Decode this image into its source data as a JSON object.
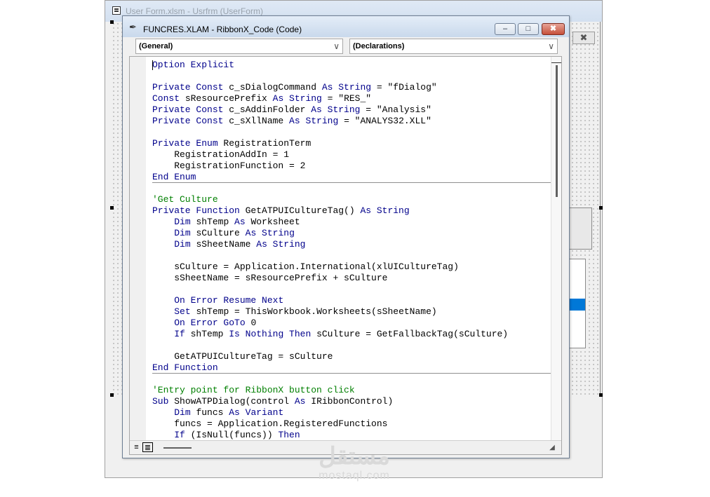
{
  "background_window": {
    "title": "User Form.xlsm - Usrfrm (UserForm)",
    "close_glyph": "✖"
  },
  "code_window": {
    "title": "FUNCRES.XLAM - RibbonX_Code (Code)",
    "icon": "vba-module-icon",
    "minimize_glyph": "–",
    "maximize_glyph": "□",
    "close_glyph": "✖",
    "object_combo": "(General)",
    "procedure_combo": "(Declarations)",
    "combo_arrow": "⌵"
  },
  "colors": {
    "keyword": "#00008b",
    "comment": "#007f00",
    "selection": "#0078d7"
  },
  "code_lines": [
    [
      {
        "t": "Option Explicit",
        "c": "kw"
      }
    ],
    [],
    [
      {
        "t": "Private Const ",
        "c": "kw"
      },
      {
        "t": "c_sDialogCommand "
      },
      {
        "t": "As String",
        "c": "kw"
      },
      {
        "t": " = \"fDialog\""
      }
    ],
    [
      {
        "t": "Const ",
        "c": "kw"
      },
      {
        "t": "sResourcePrefix "
      },
      {
        "t": "As String",
        "c": "kw"
      },
      {
        "t": " = \"RES_\""
      }
    ],
    [
      {
        "t": "Private Const ",
        "c": "kw"
      },
      {
        "t": "c_sAddinFolder "
      },
      {
        "t": "As String",
        "c": "kw"
      },
      {
        "t": " = \"Analysis\""
      }
    ],
    [
      {
        "t": "Private Const ",
        "c": "kw"
      },
      {
        "t": "c_sXllName "
      },
      {
        "t": "As String",
        "c": "kw"
      },
      {
        "t": " = \"ANALYS32.XLL\""
      }
    ],
    [],
    [
      {
        "t": "Private Enum ",
        "c": "kw"
      },
      {
        "t": "RegistrationTerm"
      }
    ],
    [
      {
        "t": "    RegistrationAddIn = 1"
      }
    ],
    [
      {
        "t": "    RegistrationFunction = 2"
      }
    ],
    [
      {
        "t": "End Enum",
        "c": "kw"
      }
    ],
    [],
    [
      {
        "t": "'Get Culture",
        "c": "cm"
      }
    ],
    [
      {
        "t": "Private Function ",
        "c": "kw"
      },
      {
        "t": "GetATPUICultureTag() "
      },
      {
        "t": "As String",
        "c": "kw"
      }
    ],
    [
      {
        "t": "    "
      },
      {
        "t": "Dim ",
        "c": "kw"
      },
      {
        "t": "shTemp "
      },
      {
        "t": "As ",
        "c": "kw"
      },
      {
        "t": "Worksheet"
      }
    ],
    [
      {
        "t": "    "
      },
      {
        "t": "Dim ",
        "c": "kw"
      },
      {
        "t": "sCulture "
      },
      {
        "t": "As String",
        "c": "kw"
      }
    ],
    [
      {
        "t": "    "
      },
      {
        "t": "Dim ",
        "c": "kw"
      },
      {
        "t": "sSheetName "
      },
      {
        "t": "As String",
        "c": "kw"
      }
    ],
    [],
    [
      {
        "t": "    sCulture = Application.International(xlUICultureTag)"
      }
    ],
    [
      {
        "t": "    sSheetName = sResourcePrefix + sCulture"
      }
    ],
    [],
    [
      {
        "t": "    "
      },
      {
        "t": "On Error Resume Next",
        "c": "kw"
      }
    ],
    [
      {
        "t": "    "
      },
      {
        "t": "Set ",
        "c": "kw"
      },
      {
        "t": "shTemp = ThisWorkbook.Worksheets(sSheetName)"
      }
    ],
    [
      {
        "t": "    "
      },
      {
        "t": "On Error GoTo ",
        "c": "kw"
      },
      {
        "t": "0"
      }
    ],
    [
      {
        "t": "    "
      },
      {
        "t": "If ",
        "c": "kw"
      },
      {
        "t": "shTemp "
      },
      {
        "t": "Is Nothing Then ",
        "c": "kw"
      },
      {
        "t": "sCulture = GetFallbackTag(sCulture)"
      }
    ],
    [],
    [
      {
        "t": "    GetATPUICultureTag = sCulture"
      }
    ],
    [
      {
        "t": "End Function",
        "c": "kw"
      }
    ],
    [],
    [
      {
        "t": "'Entry point for RibbonX button click",
        "c": "cm"
      }
    ],
    [
      {
        "t": "Sub ",
        "c": "kw"
      },
      {
        "t": "ShowATPDialog(control "
      },
      {
        "t": "As ",
        "c": "kw"
      },
      {
        "t": "IRibbonControl)"
      }
    ],
    [
      {
        "t": "    "
      },
      {
        "t": "Dim ",
        "c": "kw"
      },
      {
        "t": "funcs "
      },
      {
        "t": "As Variant",
        "c": "kw"
      }
    ],
    [
      {
        "t": "    funcs = Application.RegisteredFunctions"
      }
    ],
    [
      {
        "t": "    "
      },
      {
        "t": "If ",
        "c": "kw"
      },
      {
        "t": "(IsNull(funcs)) "
      },
      {
        "t": "Then",
        "c": "kw"
      }
    ]
  ],
  "separators_after_line": [
    10,
    27
  ],
  "view_buttons": {
    "procedure_view": "≡",
    "full_module_view": "≣"
  },
  "watermark": {
    "logo": "مستقل",
    "site": "mostaql.com"
  }
}
